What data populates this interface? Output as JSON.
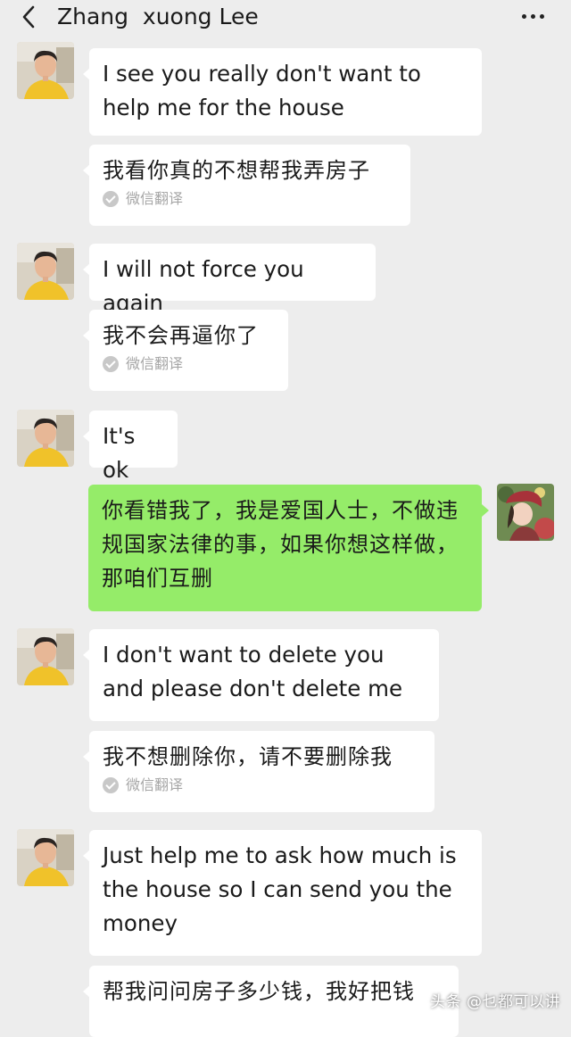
{
  "header": {
    "title": "Zhang  xuong Lee",
    "back_icon": "chevron-left-icon",
    "more_icon": "more-dots-icon"
  },
  "colors": {
    "background": "#ededed",
    "incoming_bubble": "#ffffff",
    "outgoing_bubble": "#95ec69"
  },
  "messages": [
    {
      "sender": "Zhang xuong Lee",
      "text": "I see you really don't want to help me for the house"
    },
    {
      "sender": "Zhang xuong Lee",
      "text": "我看你真的不想帮我弄房子",
      "note": "微信翻译"
    },
    {
      "sender": "Zhang xuong Lee",
      "text": "I will not force you again"
    },
    {
      "sender": "Zhang xuong Lee",
      "text": "我不会再逼你了",
      "note": "微信翻译"
    },
    {
      "sender": "Zhang xuong Lee",
      "text": "It's ok"
    },
    {
      "sender": "me",
      "text": "你看错我了，我是爱国人士，不做违规国家法律的事，如果你想这样做，那咱们互删"
    },
    {
      "sender": "Zhang xuong Lee",
      "text": "I don't want to delete you and please don't delete me"
    },
    {
      "sender": "Zhang xuong Lee",
      "text": "我不想删除你，请不要删除我",
      "note": "微信翻译"
    },
    {
      "sender": "Zhang xuong Lee",
      "text": "Just help me to ask how much is the house so I can send you the money"
    },
    {
      "sender": "Zhang xuong Lee",
      "text": "帮我问问房子多少钱，我好把钱"
    }
  ],
  "watermark": "头条 @乜都可以讲"
}
